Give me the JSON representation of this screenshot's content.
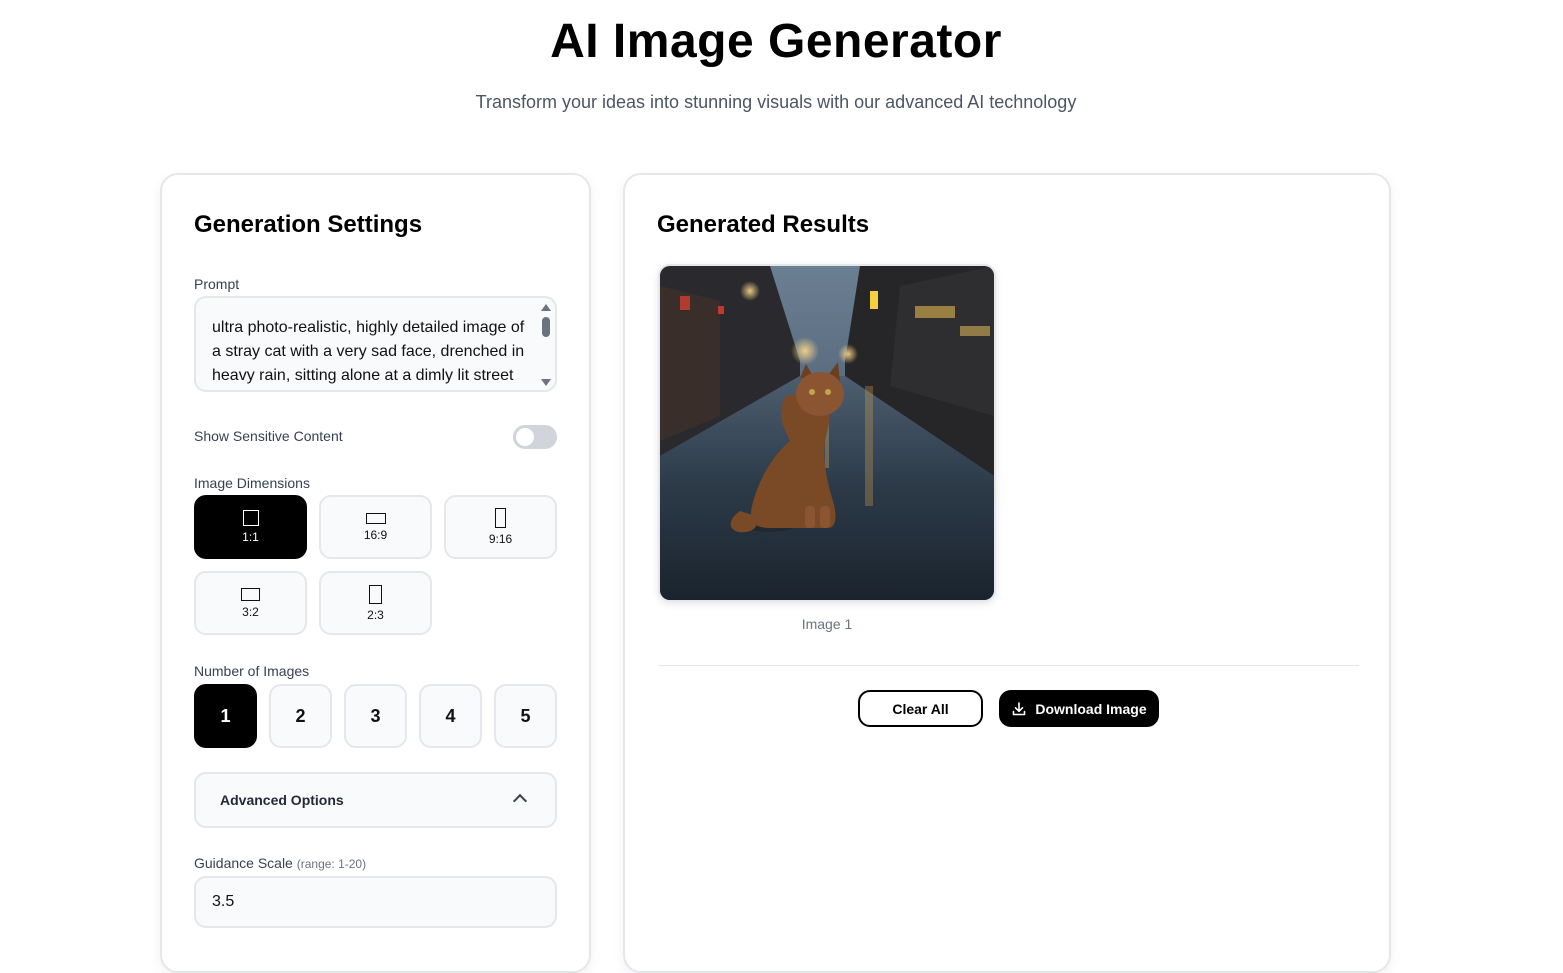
{
  "header": {
    "title": "AI Image Generator",
    "subtitle": "Transform your ideas into stunning visuals with our advanced AI technology"
  },
  "settings": {
    "title": "Generation Settings",
    "prompt_label": "Prompt",
    "prompt_value": "ultra photo-realistic, highly detailed image of a stray cat with a very sad face, drenched in heavy rain, sitting alone at a dimly lit street",
    "sensitive_label": "Show Sensitive Content",
    "sensitive_enabled": false,
    "dimensions_label": "Image Dimensions",
    "dimensions": [
      {
        "label": "1:1",
        "selected": true
      },
      {
        "label": "16:9",
        "selected": false
      },
      {
        "label": "9:16",
        "selected": false
      },
      {
        "label": "3:2",
        "selected": false
      },
      {
        "label": "2:3",
        "selected": false
      }
    ],
    "num_images_label": "Number of Images",
    "num_images": [
      "1",
      "2",
      "3",
      "4",
      "5"
    ],
    "num_images_selected": "1",
    "advanced_label": "Advanced Options",
    "guidance_label": "Guidance Scale",
    "guidance_hint": "(range: 1-20)",
    "guidance_value": "3.5"
  },
  "results": {
    "title": "Generated Results",
    "images": [
      {
        "caption": "Image 1",
        "subject": "stray cat sitting on a wet street in the rain"
      }
    ],
    "clear_label": "Clear All",
    "download_label": "Download Image"
  },
  "icons": {
    "download": "download-icon",
    "chevron": "chevron-up-icon"
  }
}
